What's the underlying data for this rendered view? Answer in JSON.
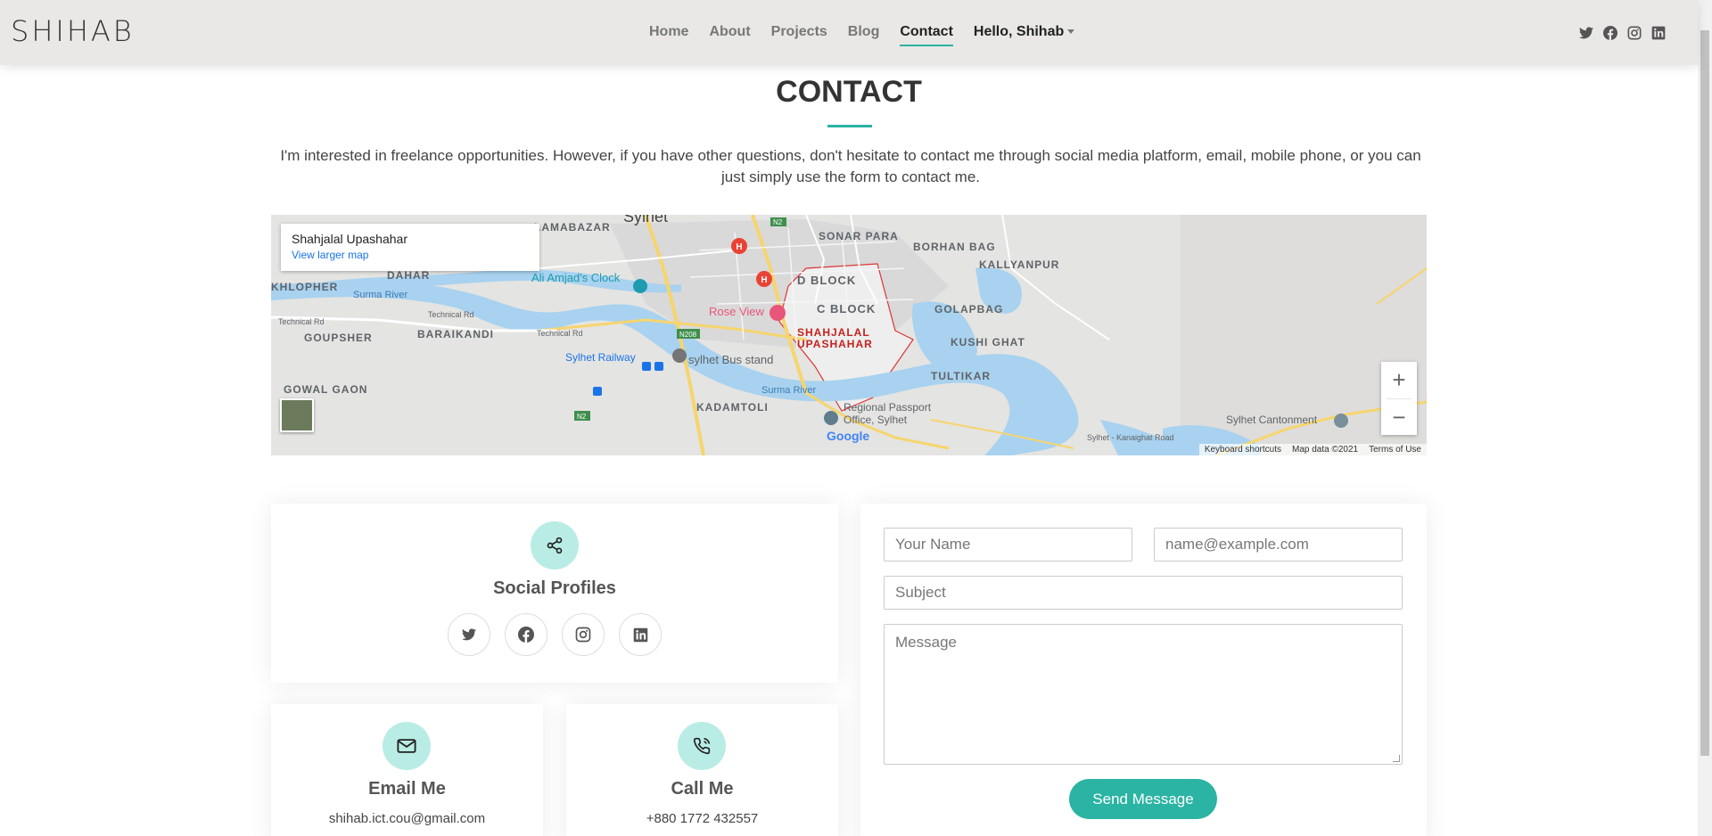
{
  "header": {
    "logo": "SHIHAB",
    "nav": [
      {
        "label": "Home"
      },
      {
        "label": "About"
      },
      {
        "label": "Projects"
      },
      {
        "label": "Blog"
      },
      {
        "label": "Contact",
        "active": true
      }
    ],
    "user_label": "Hello, Shihab",
    "social_icons": [
      "twitter-icon",
      "facebook-icon",
      "instagram-icon",
      "linkedin-icon"
    ]
  },
  "section": {
    "title": "CONTACT",
    "intro": "I'm interested in freelance opportunities. However, if you have other questions, don't hesitate to contact me through social media platform, email, mobile phone, or you can just simply use the form to contact me."
  },
  "map": {
    "place_name": "Shahjalal Upashahar",
    "larger_map_link": "View larger map",
    "zoom_in": "+",
    "zoom_out": "−",
    "footer": {
      "shortcuts": "Keyboard shortcuts",
      "map_data": "Map data ©2021",
      "terms": "Terms of Use"
    },
    "labels": {
      "sylhet": "Sylhet",
      "lamabazar": "LAMABAZAR",
      "sonar_para": "SONAR PARA",
      "borhan_bag": "BORHAN BAG",
      "kallyanpur": "KALLYANPUR",
      "dahar": "DAHAR",
      "khlopher": "KHLOPHER",
      "surma_river": "Surma River",
      "ali_amjads_clock": "Ali Amjad's Clock",
      "d_block": "D BLOCK",
      "c_block": "C BLOCK",
      "golapbag": "GOLAPBAG",
      "technical_rd": "Technical Rd",
      "goupsher": "GOUPSHER",
      "baraikandi": "BARAIKANDI",
      "rose_view": "Rose View",
      "shahjalal_upashahar_1": "SHAHJALAL",
      "shahjalal_upashahar_2": "UPASHAHAR",
      "kushi_ghat": "KUSHI GHAT",
      "n208": "N208",
      "n2": "N2",
      "sylhet_railway": "Sylhet Railway",
      "sylhet_bus_stand": "sylhet Bus stand",
      "tultikar": "TULTIKAR",
      "gowal_gaon": "GOWAL GAON",
      "kadamtoli": "KADAMTOLI",
      "regional_passport_1": "Regional Passport",
      "regional_passport_2": "Office, Sylhet",
      "sylhet_cantonment": "Sylhet Cantonment",
      "kanaighat_road": "Sylhet - Kanaighat Road",
      "google": "Google"
    }
  },
  "social_card": {
    "title": "Social Profiles",
    "icons": [
      "twitter-icon",
      "facebook-icon",
      "instagram-icon",
      "linkedin-icon"
    ]
  },
  "email_card": {
    "title": "Email Me",
    "value": "shihab.ict.cou@gmail.com"
  },
  "call_card": {
    "title": "Call Me",
    "value": "+880 1772 432557"
  },
  "form": {
    "name_placeholder": "Your Name",
    "email_placeholder": "name@example.com",
    "subject_placeholder": "Subject",
    "message_placeholder": "Message",
    "submit_label": "Send Message"
  },
  "colors": {
    "accent": "#2bb3a3",
    "icon_bg": "#b9ece4",
    "header_bg": "#e9e8e6"
  }
}
